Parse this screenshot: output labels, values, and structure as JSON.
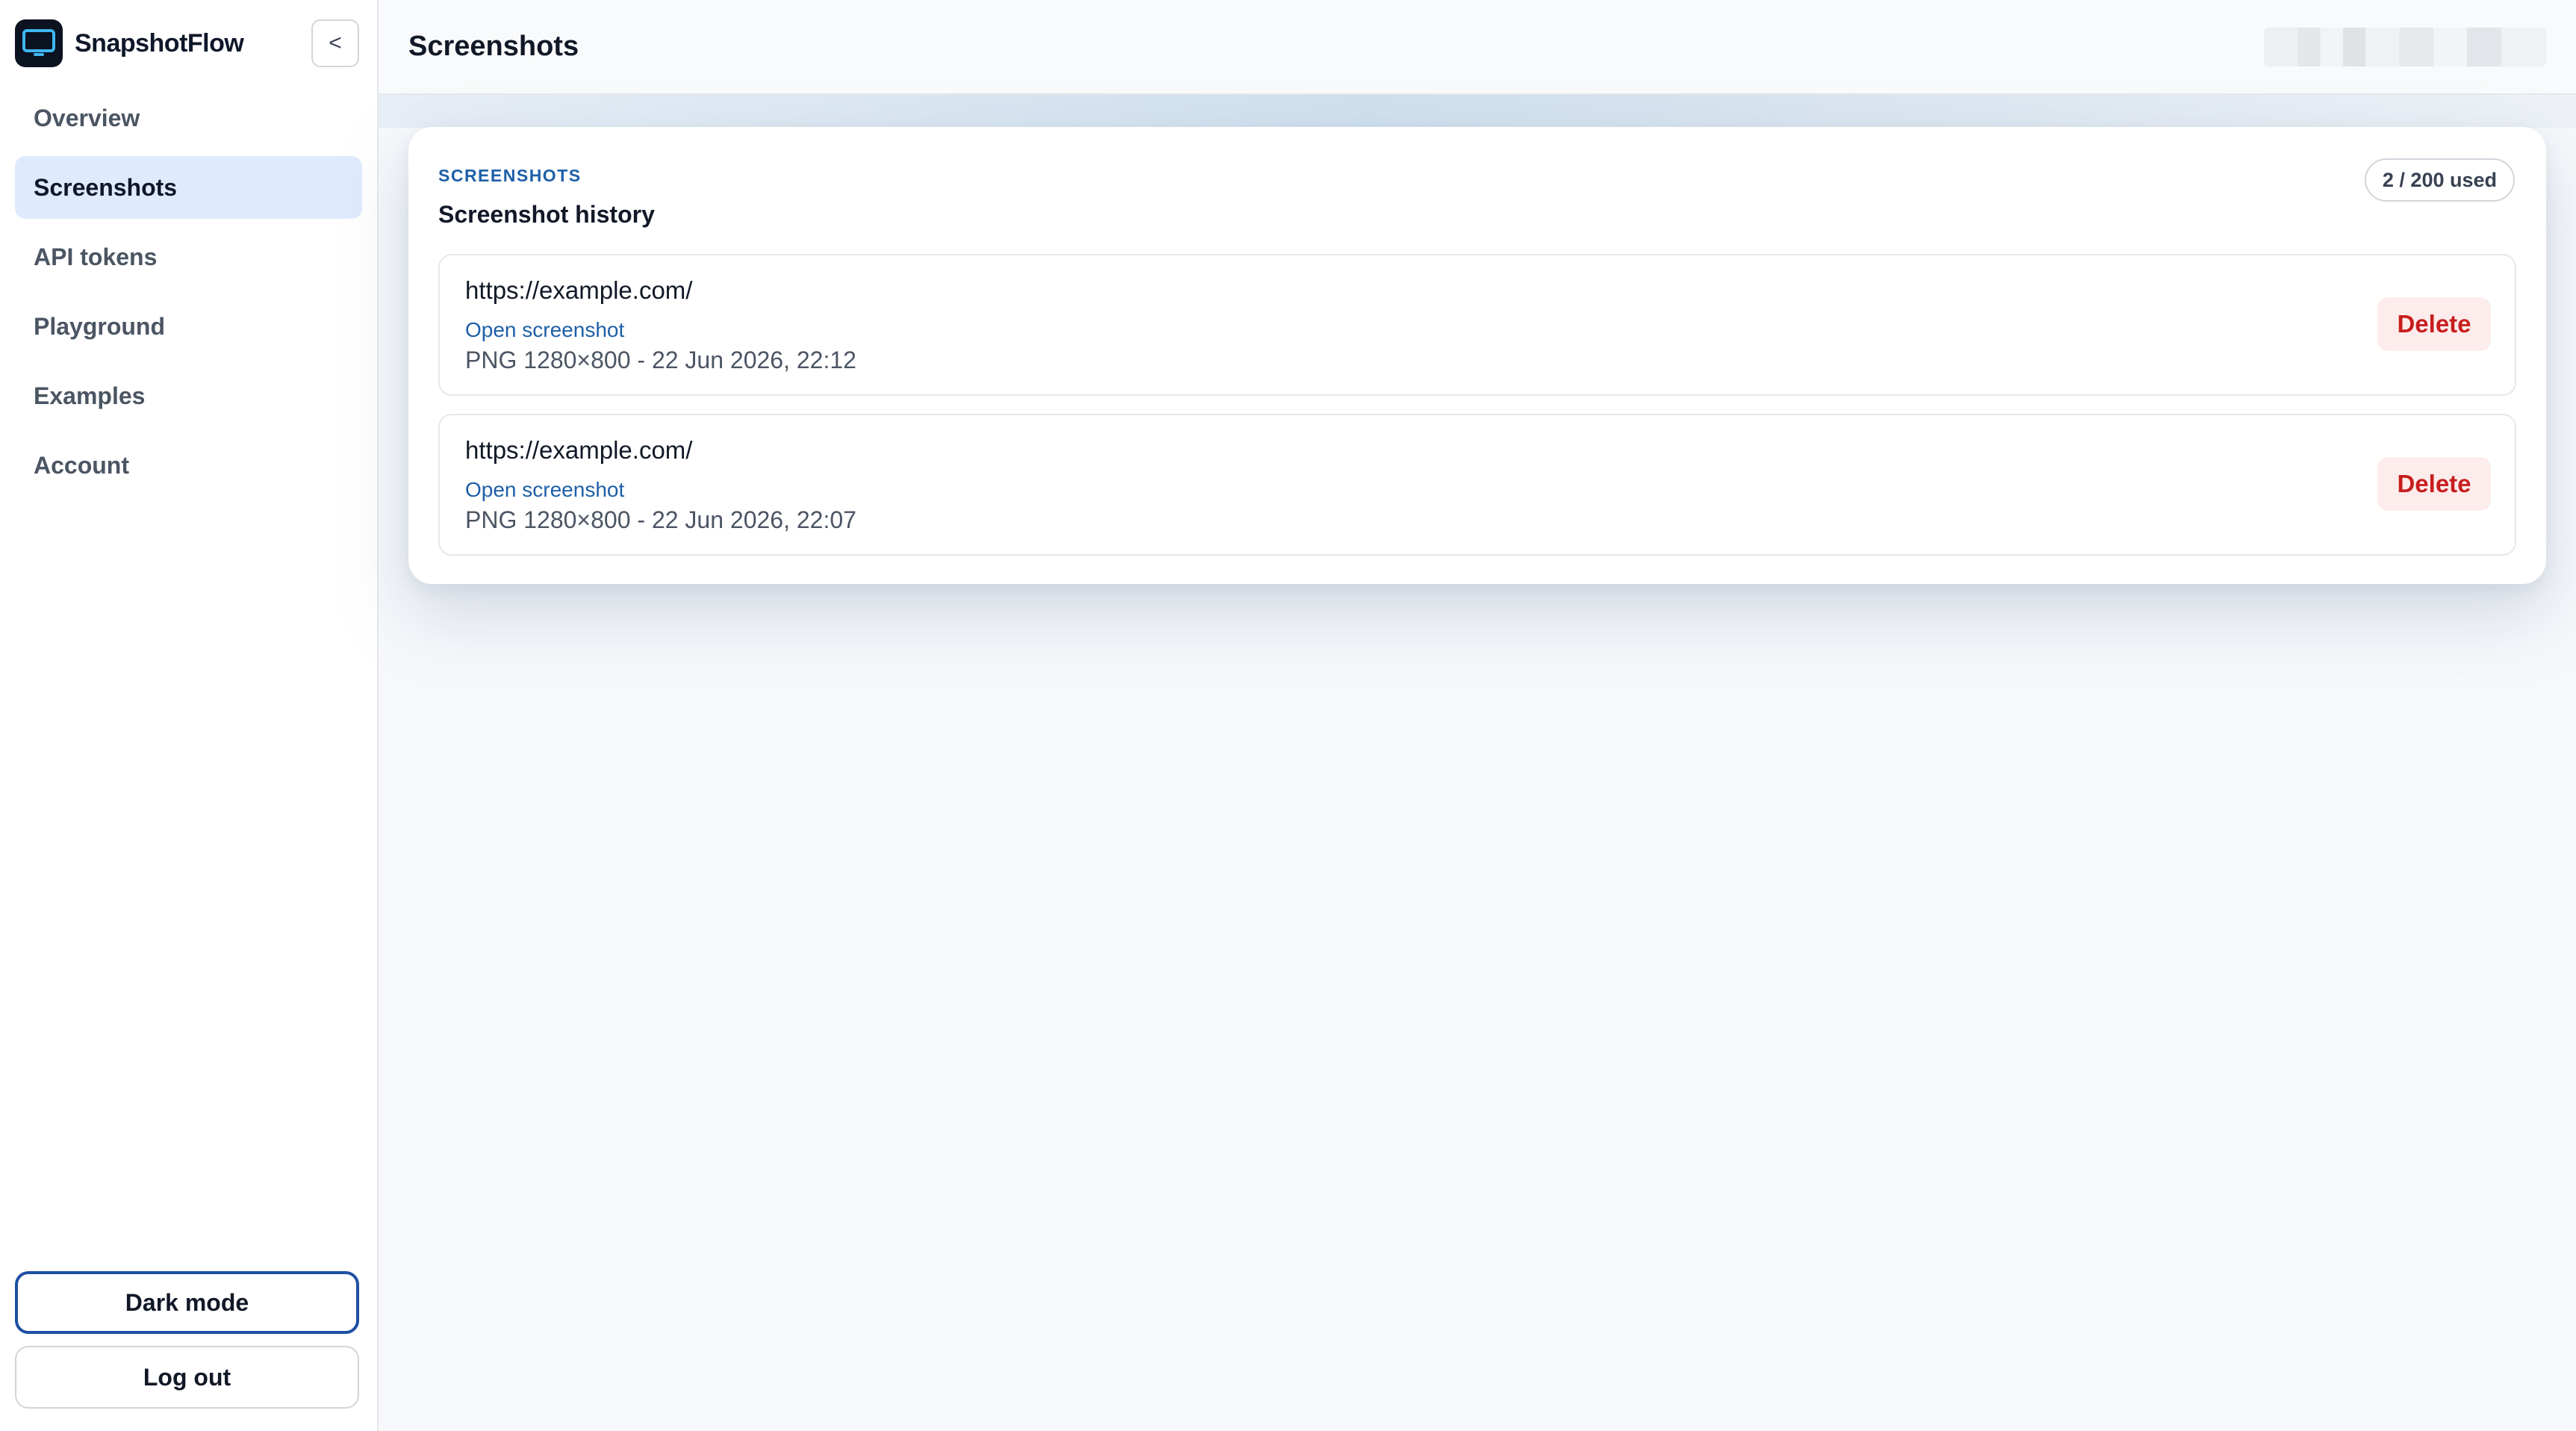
{
  "app": {
    "name": "SnapshotFlow",
    "collapse_label": "<"
  },
  "sidebar": {
    "items": [
      {
        "label": "Overview",
        "active": false
      },
      {
        "label": "Screenshots",
        "active": true
      },
      {
        "label": "API tokens",
        "active": false
      },
      {
        "label": "Playground",
        "active": false
      },
      {
        "label": "Examples",
        "active": false
      },
      {
        "label": "Account",
        "active": false
      }
    ],
    "dark_mode_label": "Dark mode",
    "logout_label": "Log out"
  },
  "header": {
    "title": "Screenshots"
  },
  "card": {
    "eyebrow": "SCREENSHOTS",
    "title": "Screenshot history",
    "usage": "2 / 200 used",
    "items": [
      {
        "url": "https://example.com/",
        "link_label": "Open screenshot",
        "meta": "PNG 1280×800 - 22 Jun 2026, 22:12",
        "delete_label": "Delete"
      },
      {
        "url": "https://example.com/",
        "link_label": "Open screenshot",
        "meta": "PNG 1280×800 - 22 Jun 2026, 22:07",
        "delete_label": "Delete"
      }
    ]
  },
  "colors": {
    "accent": "#1e5fa8",
    "active_nav_bg": "#dfeafd",
    "danger": "#c81e1e",
    "danger_bg": "#fdecec"
  },
  "icons": {
    "brand": "monitor-icon"
  }
}
